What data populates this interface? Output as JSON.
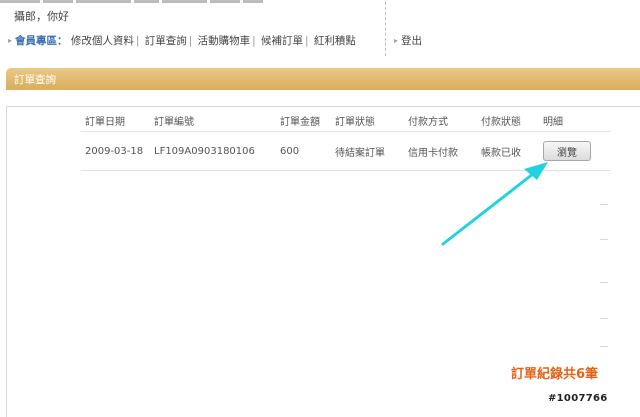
{
  "header": {
    "greeting": "攝郎，你好"
  },
  "member_nav": {
    "label": "會員專區：",
    "links": [
      "修改個人資料",
      "訂單查詢",
      "活動購物車",
      "候補訂單",
      "紅利積點"
    ],
    "logout": "登出"
  },
  "section": {
    "title": "訂單查詢"
  },
  "orders_table": {
    "columns": [
      "訂單日期",
      "訂單編號",
      "訂單金額",
      "訂單狀態",
      "付款方式",
      "付款狀態",
      "明細"
    ],
    "rows": [
      {
        "date": "2009-03-18",
        "order_no": "LF109A0903180106",
        "amount": "600",
        "status": "待結案訂單",
        "payment_method": "信用卡付款",
        "payment_status": "帳款已收",
        "detail_button": "瀏覽"
      }
    ]
  },
  "summary": {
    "record_count": "訂單紀錄共6筆"
  },
  "watermark": "#1007766",
  "colors": {
    "section_bar": "#d9ad5c",
    "nav_label": "#3b6fb5",
    "arrow": "#1fd3e0",
    "record_count": "#e4631a"
  }
}
